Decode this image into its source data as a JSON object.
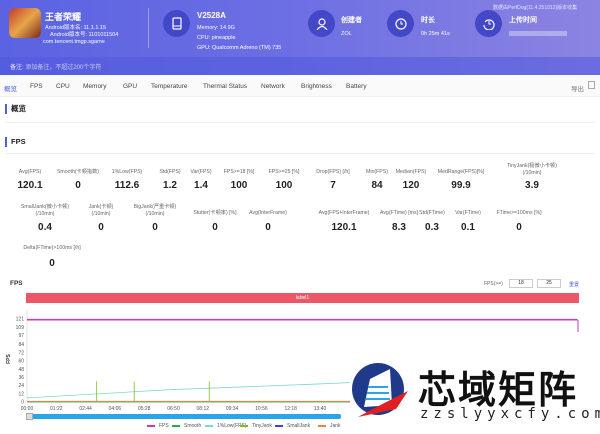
{
  "header": {
    "app_name": "王者荣耀",
    "android_version": "Android版本名: 11.1.1.15",
    "android_code": "Android版本号: 1101011504",
    "package": "com.tencent.tmgp.sgame",
    "device": "V2528A",
    "memory": "Memory: 14.9G",
    "cpu": "CPU: pineapple",
    "gpu": "GPU: Qualcomm Adreno (TM) 735",
    "creator_label": "创建者",
    "creator": "ZOL",
    "duration_label": "时长",
    "duration": "0h 25m 41s",
    "upload_label": "上传时间",
    "source": "数据由PerfDog(11.4.251012)版本收集",
    "remark_label": "备注:",
    "remark_placeholder": "添加备注，不超过200个字符"
  },
  "tabs": [
    "概览",
    "FPS",
    "CPU",
    "Memory",
    "GPU",
    "Temperature",
    "Thermal Status",
    "Network",
    "Brightness",
    "Battery"
  ],
  "export_label": "导出",
  "sections": {
    "overview": "概览",
    "fps": "FPS"
  },
  "metrics_row1": [
    [
      "Avg(FPS)",
      "120.1"
    ],
    [
      "Smooth(卡顿指数)",
      "0"
    ],
    [
      "1%Low(FPS)",
      "112.6"
    ],
    [
      "Std(FPS)",
      "1.2"
    ],
    [
      "Var(FPS)",
      "1.4"
    ],
    [
      "FPS>=18 [%]",
      "100"
    ],
    [
      "FPS>=25 [%]",
      "100"
    ],
    [
      "Drop(FPS) [/h]",
      "7"
    ],
    [
      "Min(FPS)",
      "84"
    ],
    [
      "Median(FPS)",
      "120"
    ],
    [
      "MedRange(FPS)[%]",
      "99.9"
    ],
    [
      "TinyJank(极微小卡顿)\n(/10min)",
      "3.9"
    ]
  ],
  "metrics_row2": [
    [
      "SmallJank(微小卡顿)\n(/10min)",
      "0.4"
    ],
    [
      "Jank(卡顿)\n(/10min)",
      "0"
    ],
    [
      "BigJank(严重卡顿)\n(/10min)",
      "0"
    ],
    [
      "Stutter(卡顿率) [%]",
      "0"
    ],
    [
      "Avg(InterFrame)",
      "0"
    ],
    [
      "Avg(FPS+InterFrame)",
      "120.1"
    ],
    [
      "Avg(FTime) [ms]",
      "8.3"
    ],
    [
      "Std(FTime)",
      "0.3"
    ],
    [
      "Var(FTime)",
      "0.1"
    ],
    [
      "FTime>=100ms [%]",
      "0"
    ]
  ],
  "metrics_row3": [
    [
      "Delta(FTime)>100ms [/h]",
      "0"
    ]
  ],
  "chart_controls": {
    "label": "FPS(>=)",
    "v1": "18",
    "v2": "25",
    "reset": "重置"
  },
  "watermark": {
    "name": "芯域矩阵",
    "url": "zzslyyxcfy.com"
  },
  "chart_data": {
    "type": "line",
    "title": "FPS",
    "ylabel": "FPS",
    "label_bar": "label1",
    "ylim": [
      0,
      121
    ],
    "yticks": [
      "0",
      "12",
      "24",
      "36",
      "48",
      "60",
      "72",
      "84",
      "97",
      "109",
      "121"
    ],
    "xticks": [
      "00:00",
      "01:22",
      "02:44",
      "04:06",
      "05:28",
      "06:50",
      "08:12",
      "09:34",
      "10:56",
      "12:18",
      "13:40"
    ],
    "duration_s": 1541,
    "series": [
      {
        "name": "FPS",
        "color": "#c83cb4",
        "points": [
          [
            0,
            120
          ],
          [
            1541,
            120
          ]
        ]
      },
      {
        "name": "Smooth",
        "color": "#2ea84a",
        "points": [
          [
            0,
            0
          ],
          [
            1541,
            0
          ]
        ]
      },
      {
        "name": "1%Low(FPS)",
        "color": "#7fd6d0",
        "points": [
          [
            0,
            6
          ],
          [
            400,
            18
          ],
          [
            800,
            26
          ],
          [
            1030,
            31
          ],
          [
            1040,
            25
          ],
          [
            1541,
            28
          ]
        ]
      },
      {
        "name": "TinyJank",
        "color": "#7cbd1a",
        "spikes": [
          [
            195,
            30
          ],
          [
            300,
            30
          ],
          [
            510,
            30
          ]
        ]
      },
      {
        "name": "SmallJank",
        "color": "#4040e0",
        "points": []
      },
      {
        "name": "Jank",
        "color": "#f08040",
        "points": [
          [
            0,
            1
          ],
          [
            1541,
            1
          ]
        ]
      }
    ]
  }
}
